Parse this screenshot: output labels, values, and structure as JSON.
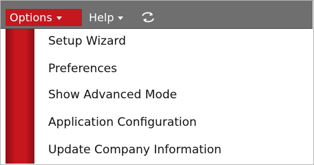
{
  "menubar": {
    "options_label": "Options",
    "help_label": "Help"
  },
  "dropdown": {
    "items": [
      {
        "label": "Setup Wizard"
      },
      {
        "label": "Preferences"
      },
      {
        "label": "Show Advanced Mode"
      },
      {
        "label": "Application Configuration"
      },
      {
        "label": "Update Company Information"
      }
    ]
  },
  "colors": {
    "accent": "#c4171e",
    "menubar": "#6f6f6f",
    "stripe_dark": "#8f0d13"
  },
  "icons": {
    "sync": "sync-arrows-icon",
    "caret": "caret-down-icon"
  }
}
